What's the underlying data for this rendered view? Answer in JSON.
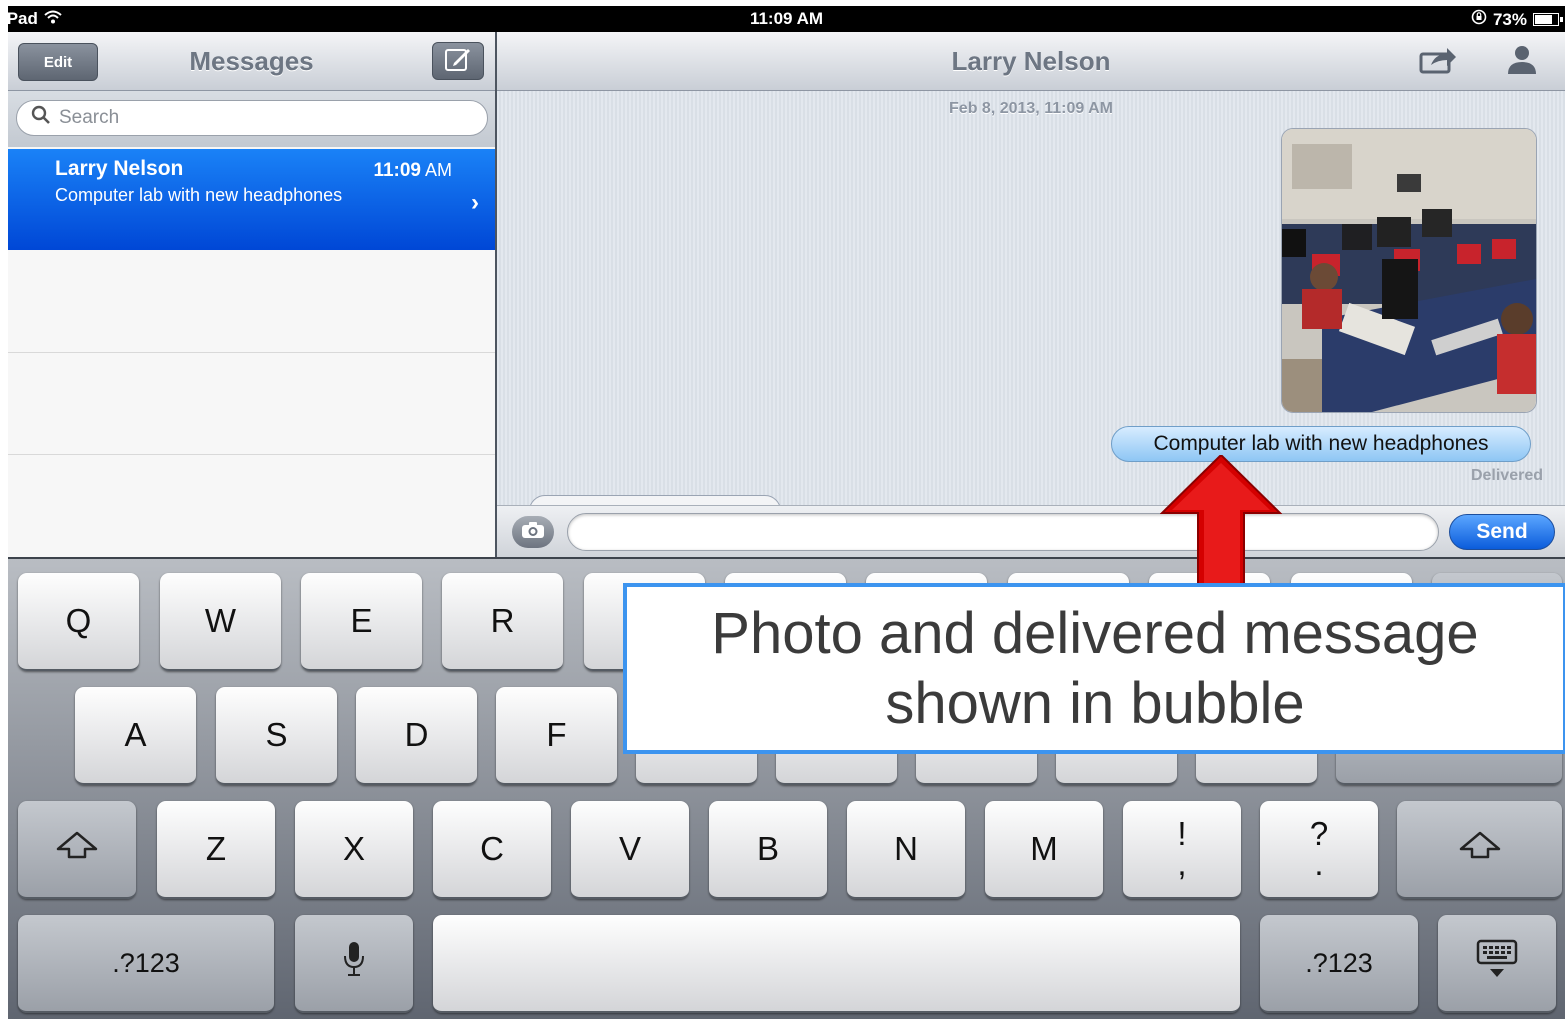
{
  "status_bar": {
    "device": "iPad",
    "time": "11:09 AM",
    "battery": "73%"
  },
  "left_pane": {
    "edit_label": "Edit",
    "title": "Messages",
    "search_placeholder": "Search",
    "conversation": {
      "name": "Larry Nelson",
      "time_value": "11:09",
      "time_suffix": "AM",
      "preview": "Computer lab with new headphones"
    }
  },
  "right_pane": {
    "contact_name": "Larry Nelson",
    "timestamp": "Feb 8, 2013, 11:09 AM",
    "message_text": "Computer lab with new headphones",
    "delivered": "Delivered",
    "send_label": "Send"
  },
  "keyboard": {
    "row1": [
      "Q",
      "W",
      "E",
      "R"
    ],
    "row2": [
      "A",
      "S",
      "D",
      "F"
    ],
    "row3": [
      "Z",
      "X",
      "C",
      "V",
      "B",
      "N",
      "M"
    ],
    "punct1": {
      "top": "!",
      "bottom": ","
    },
    "punct2": {
      "top": "?",
      "bottom": "."
    },
    "numbers_label": ".?123"
  },
  "annotation": {
    "line1": "Photo and delivered message",
    "line2": "shown in bubble"
  },
  "colors": {
    "selected_row": "#0a5fe6",
    "send_button": "#0b5cdb",
    "callout_border": "#3c94ef",
    "arrow": "#d40000"
  }
}
